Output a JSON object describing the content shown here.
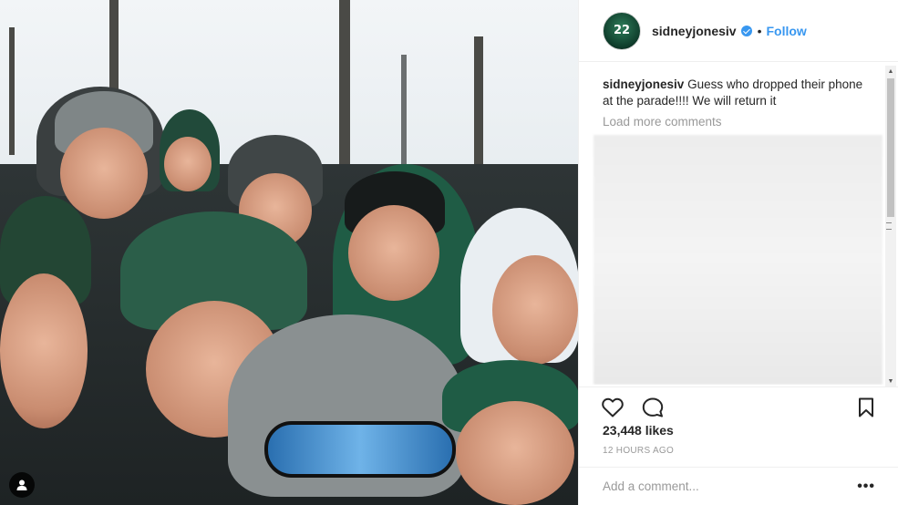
{
  "post": {
    "author": {
      "username": "sidneyjonesiv",
      "avatar_text": "22",
      "verified": true
    },
    "header": {
      "separator": "•",
      "follow_label": "Follow"
    },
    "caption": {
      "username": "sidneyjonesiv",
      "text": "Guess who dropped their phone at the parade!!!! We will return it"
    },
    "load_more_label": "Load more comments",
    "likes_text": "23,448 likes",
    "timestamp": "12 HOURS AGO",
    "add_comment_placeholder": "Add a comment...",
    "more_options": "•••"
  },
  "icons": {
    "like": "heart-icon",
    "comment": "comment-bubble-icon",
    "save": "bookmark-icon",
    "tagged_user": "user-icon",
    "verified": "verified-badge-icon"
  },
  "colors": {
    "link": "#3897f0",
    "text": "#262626",
    "muted": "#999999",
    "border": "#efefef"
  }
}
